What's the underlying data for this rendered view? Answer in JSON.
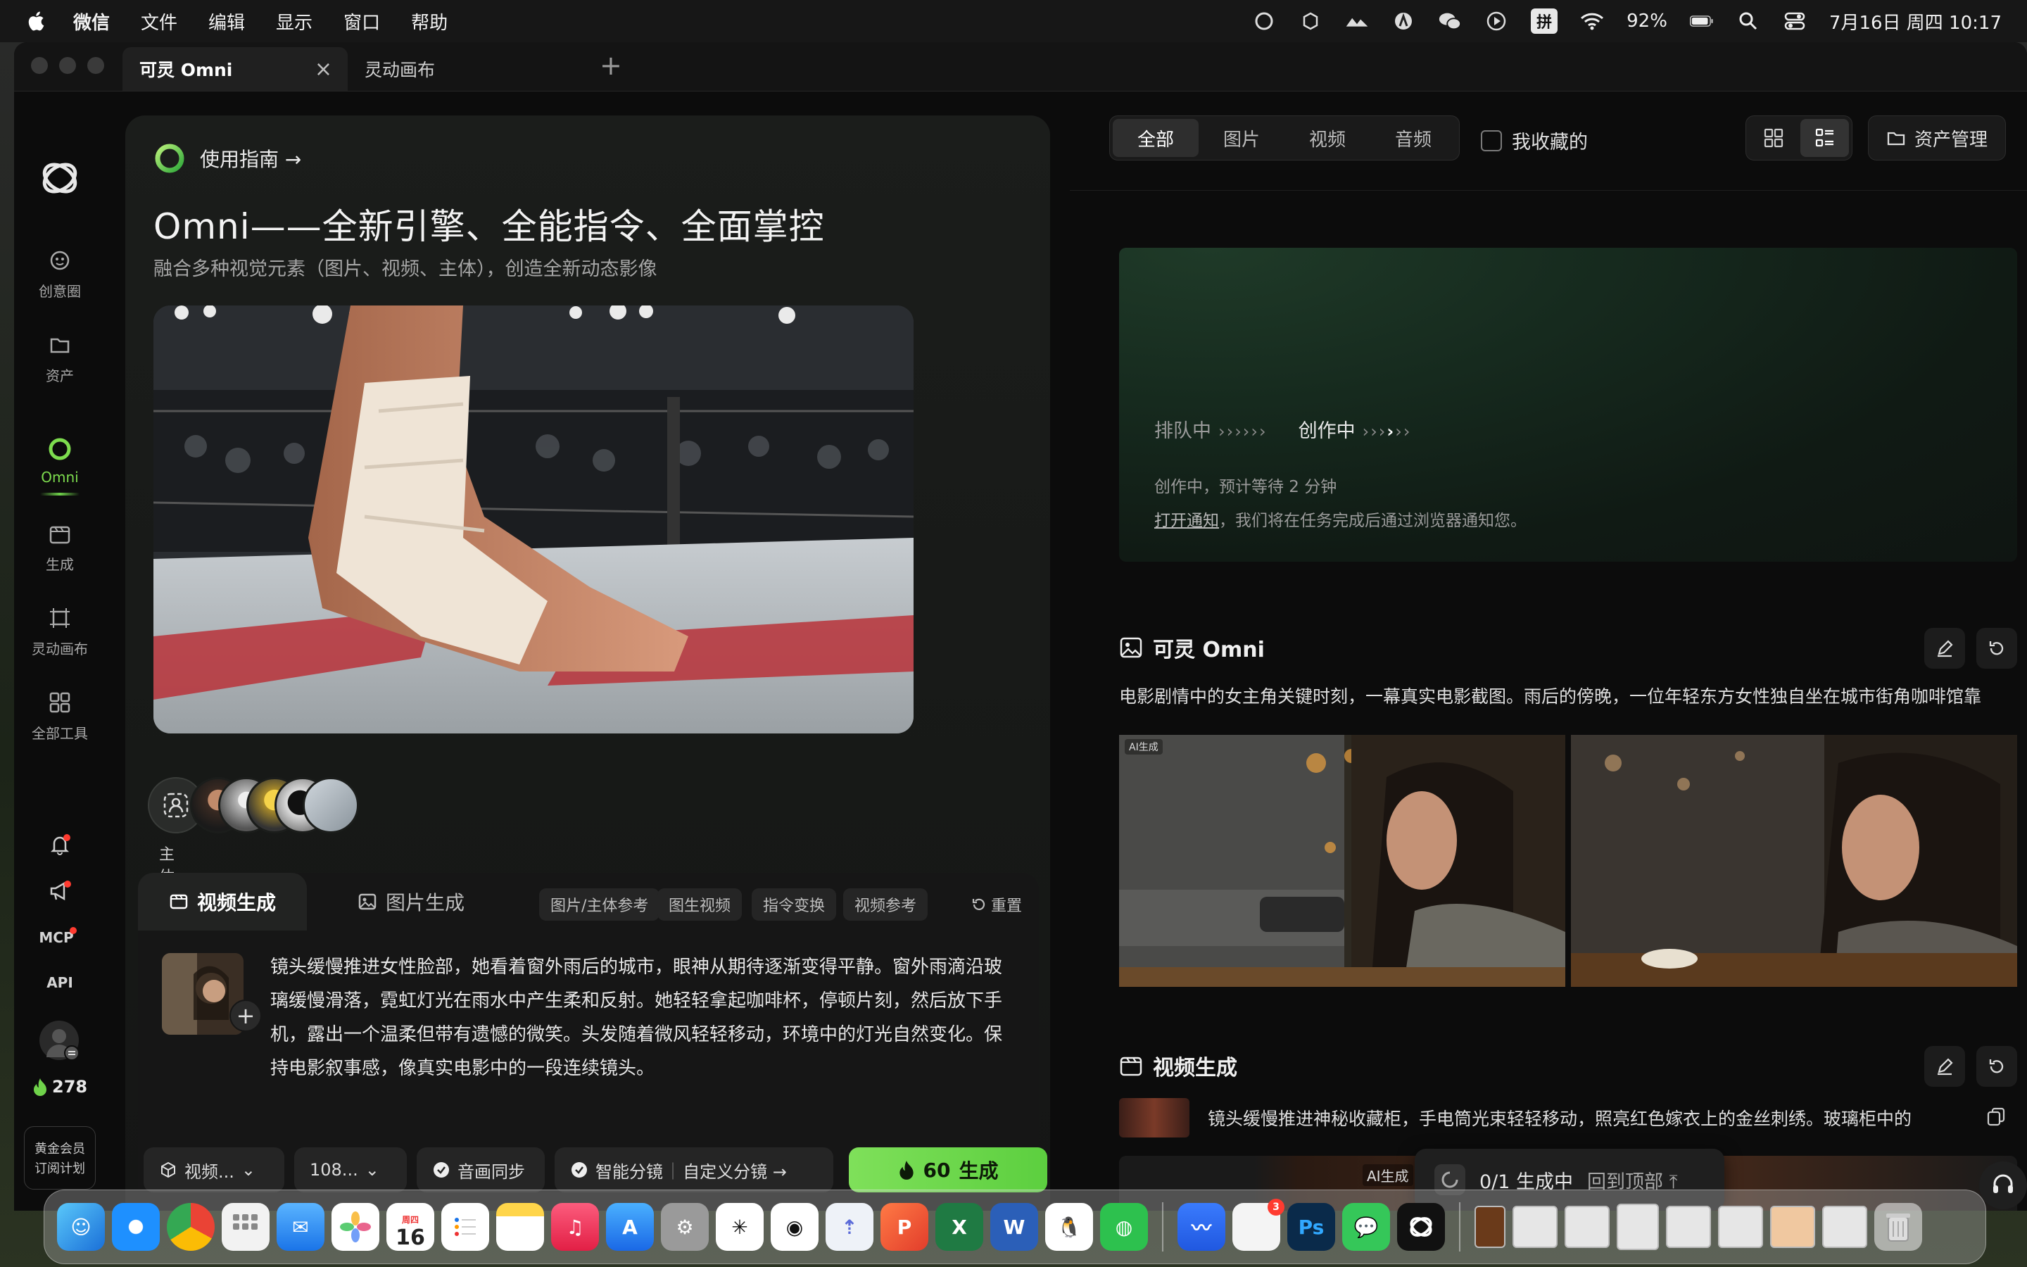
{
  "menubar": {
    "app_name": "微信",
    "menus": [
      "文件",
      "编辑",
      "显示",
      "窗口",
      "帮助"
    ],
    "battery": "92%",
    "input_method": "拼",
    "datetime": "7月16日 周四 10:17"
  },
  "browser": {
    "tabs": [
      {
        "label": "可灵 Omni",
        "active": true
      },
      {
        "label": "灵动画布",
        "active": false
      }
    ]
  },
  "rail": {
    "items": [
      {
        "label": "创意圈",
        "icon": "community-icon"
      },
      {
        "label": "资产",
        "icon": "folder-icon"
      },
      {
        "label": "Omni",
        "icon": "omni-icon",
        "active": true
      },
      {
        "label": "生成",
        "icon": "generate-icon"
      },
      {
        "label": "灵动画布",
        "icon": "canvas-icon"
      },
      {
        "label": "全部工具",
        "icon": "grid-icon"
      }
    ],
    "mcp_label": "MCP",
    "api_label": "API",
    "credits": "278",
    "vip_line1": "黄金会员",
    "vip_line2": "订阅计划",
    "more": "···"
  },
  "center": {
    "guide_label": "使用指南 →",
    "title": "Omni——全新引擎、全能指令、全面掌控",
    "subtitle": "融合多种视觉元素（图片、视频、主体），创造全新动态影像",
    "subject_label": "主体",
    "composer": {
      "tab_video": "视频生成",
      "tab_image": "图片生成",
      "chips": [
        "图片/主体参考",
        "图生视频",
        "指令变换",
        "视频参考"
      ],
      "reset": "重置",
      "prompt": "镜头缓慢推进女性脸部，她看着窗外雨后的城市，眼神从期待逐渐变得平静。窗外雨滴沿玻璃缓慢滑落，霓虹灯光在雨水中产生柔和反射。她轻轻拿起咖啡杯，停顿片刻，然后放下手机，露出一个温柔但带有遗憾的微笑。头发随着微风轻轻移动，环境中的灯光自然变化。保持电影叙事感，像真实电影中的一段连续镜头。",
      "ctl_mode": "视频...",
      "ctl_res": "108...",
      "ctl_audio": "音画同步",
      "ctl_smart": "智能分镜",
      "ctl_custom": "自定义分镜 →",
      "gen_cost": "60",
      "gen_label": "生成"
    }
  },
  "right": {
    "filters": [
      "全部",
      "图片",
      "视频",
      "音频"
    ],
    "favorites": "我收藏的",
    "assets_button": "资产管理",
    "queue": {
      "queued": "排队中",
      "creating": "创作中",
      "eta": "创作中，预计等待 2 分钟",
      "notify_link": "打开通知",
      "notify_text": "，我们将在任务完成后通过浏览器通知您。"
    },
    "result1": {
      "title": "可灵 Omni",
      "desc": "电影剧情中的女主角关键时刻，一幕真实电影截图。雨后的傍晚，一位年轻东方女性独自坐在城市街角咖啡馆靠",
      "ai_tag": "AI生成"
    },
    "result2": {
      "title": "视频生成",
      "desc": "镜头缓慢推进神秘收藏柜，手电筒光束轻轻移动，照亮红色嫁衣上的金丝刺绣。玻璃柜中的",
      "ai_tag": "AI生成"
    },
    "status": {
      "progress": "0/1 生成中",
      "back_top": "回到顶部"
    }
  },
  "dock": {
    "calendar_month": "周四",
    "calendar_day": "16",
    "badge": "3",
    "ps_label": "Ps"
  }
}
